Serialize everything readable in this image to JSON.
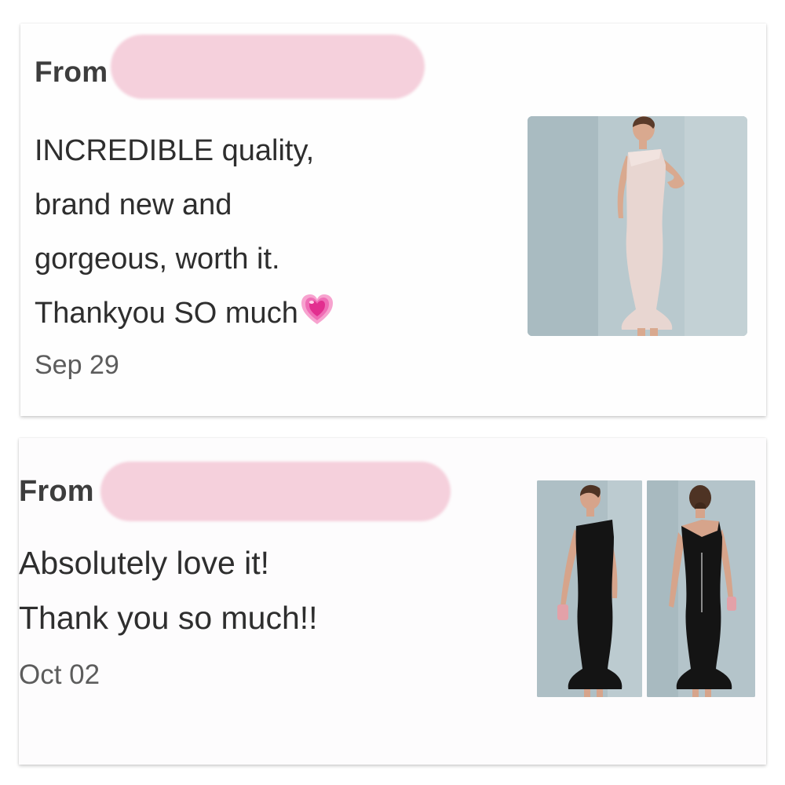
{
  "reviews": [
    {
      "from_label": "From",
      "message_lines": [
        "INCREDIBLE quality,",
        "brand new and",
        "gorgeous, worth it.",
        "Thankyou SO much"
      ],
      "emoji_icon": "growing-heart-icon",
      "date": "Sep 29",
      "photos": [
        {
          "dress_color": "#e8d6d1",
          "view": "front"
        }
      ]
    },
    {
      "from_label": "From",
      "message_lines": [
        "Absolutely love it!",
        "Thank you so much!!"
      ],
      "date": "Oct 02",
      "photos": [
        {
          "dress_color": "#141414",
          "view": "front"
        },
        {
          "dress_color": "#141414",
          "view": "back"
        }
      ]
    }
  ],
  "colors": {
    "redaction": "#f5d0dc",
    "heart": "#e83e9c",
    "card_shadow": "#cfcfcf"
  }
}
